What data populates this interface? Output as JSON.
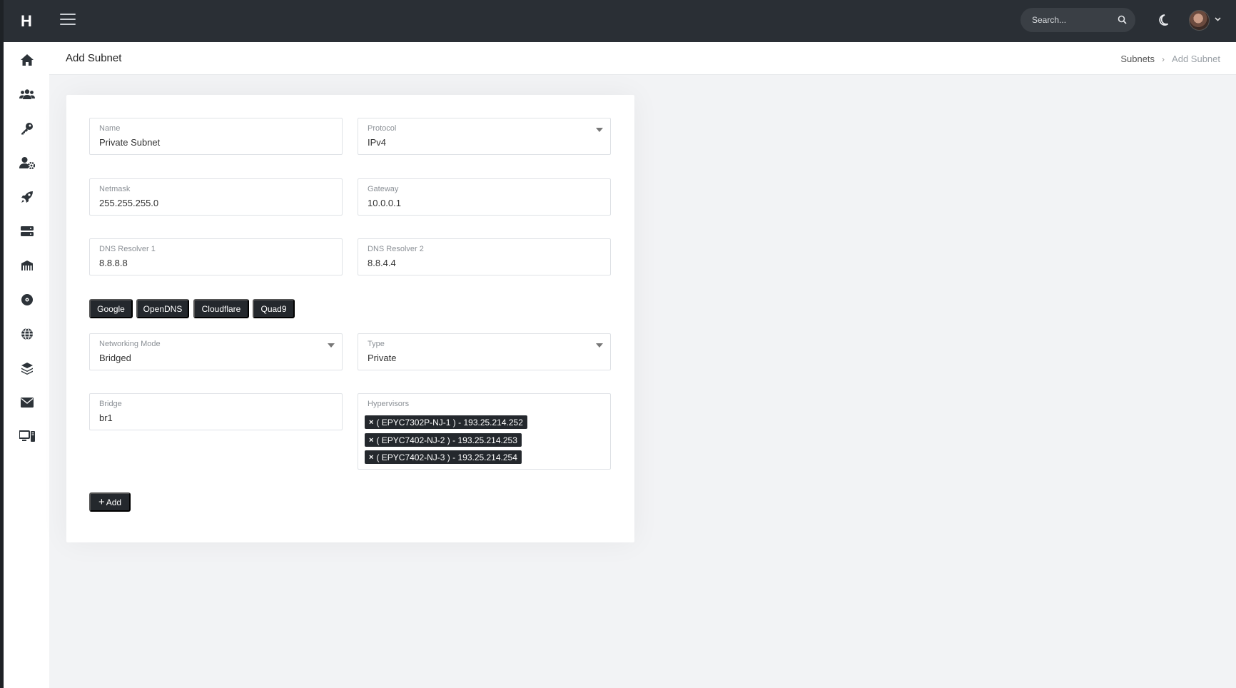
{
  "brand": {
    "letter": "H"
  },
  "search": {
    "placeholder": "Search..."
  },
  "sidebar": {
    "icons": [
      "home-icon",
      "users-icon",
      "key-icon",
      "user-cog-icon",
      "rocket-icon",
      "server-icon",
      "network-icon",
      "disk-icon",
      "globe-icon",
      "layers-icon",
      "envelope-icon",
      "desktop-icon"
    ]
  },
  "page": {
    "title": "Add Subnet",
    "breadcrumb": {
      "parent": "Subnets",
      "separator": "›",
      "current": "Add Subnet"
    }
  },
  "form": {
    "name": {
      "label": "Name",
      "value": "Private Subnet"
    },
    "protocol": {
      "label": "Protocol",
      "value": "IPv4"
    },
    "netmask": {
      "label": "Netmask",
      "value": "255.255.255.0"
    },
    "gateway": {
      "label": "Gateway",
      "value": "10.0.0.1"
    },
    "dns1": {
      "label": "DNS Resolver 1",
      "value": "8.8.8.8"
    },
    "dns2": {
      "label": "DNS Resolver 2",
      "value": "8.8.4.4"
    },
    "dns_presets": [
      "Google",
      "OpenDNS",
      "Cloudflare",
      "Quad9"
    ],
    "networking_mode": {
      "label": "Networking Mode",
      "value": "Bridged"
    },
    "type": {
      "label": "Type",
      "value": "Private"
    },
    "bridge": {
      "label": "Bridge",
      "value": "br1"
    },
    "hypervisors": {
      "label": "Hypervisors",
      "remove_symbol": "×",
      "selected": [
        "( EPYC7302P-NJ-1 ) - 193.25.214.252",
        "( EPYC7402-NJ-2 ) - 193.25.214.253",
        "( EPYC7402-NJ-3 ) - 193.25.214.254"
      ]
    },
    "add_button": {
      "plus": "+",
      "label": "Add"
    }
  },
  "colors": {
    "topbar": "#2a2f35",
    "button": "#24282d",
    "background": "#f2f3f5"
  }
}
